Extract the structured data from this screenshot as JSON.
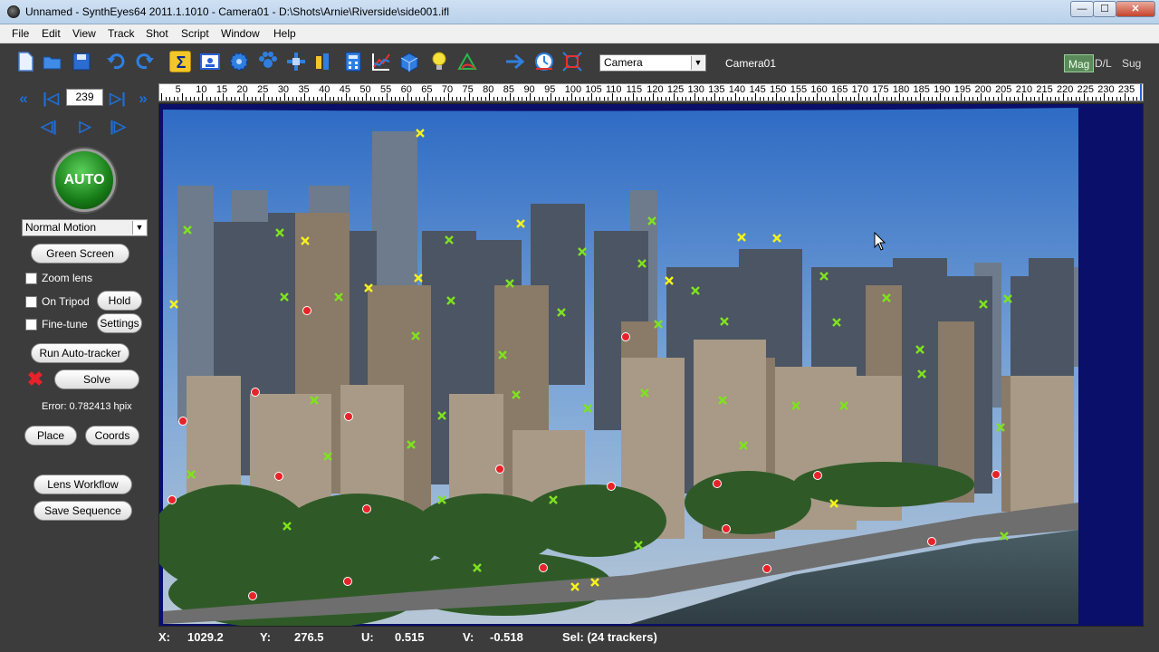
{
  "window": {
    "title": "Unnamed - SynthEyes64 2011.1.1010 - Camera01 - D:\\Shots\\Arnie\\Riverside\\side001.ifl",
    "min_label": "—",
    "max_label": "☐",
    "close_label": "✕"
  },
  "menu": [
    "File",
    "Edit",
    "View",
    "Track",
    "Shot",
    "Script",
    "Window",
    "Help"
  ],
  "toolbar": {
    "icons": [
      "new-file-icon",
      "open-folder-icon",
      "save-icon",
      "undo-icon",
      "redo-icon",
      "sigma-icon",
      "camera-view-icon",
      "gear-icon",
      "paw-icon",
      "transform-icon",
      "coordinate-icon",
      "calculator-icon",
      "graph-icon",
      "cube-icon",
      "light-bulb-icon",
      "perspective-icon",
      "arrow-right-icon",
      "clock-icon",
      "fit-icon"
    ],
    "camera_select_value": "Camera",
    "camera_label": "Camera01",
    "view_tabs": [
      "Mag",
      "D/L",
      "Sug"
    ]
  },
  "nav": {
    "frame_value": "239"
  },
  "left_panel": {
    "auto_label": "AUTO",
    "motion_select_value": "Normal Motion",
    "green_screen_label": "Green Screen",
    "zoom_lens_label": "Zoom lens",
    "on_tripod_label": "On Tripod",
    "hold_label": "Hold",
    "fine_tune_label": "Fine-tune",
    "settings_label": "Settings",
    "run_auto_tracker_label": "Run Auto-tracker",
    "solve_label": "Solve",
    "error_text": "Error: 0.782413 hpix",
    "place_label": "Place",
    "coords_label": "Coords",
    "lens_workflow_label": "Lens Workflow",
    "save_sequence_label": "Save Sequence"
  },
  "timeline": {
    "labels": [
      "5",
      "10",
      "15",
      "20",
      "25",
      "30",
      "35",
      "40",
      "45",
      "50",
      "55",
      "60",
      "65",
      "70",
      "75",
      "80",
      "85",
      "90",
      "95",
      "100",
      "105",
      "110",
      "115",
      "120",
      "125",
      "130",
      "135",
      "140",
      "145",
      "150",
      "155",
      "160",
      "165",
      "170",
      "175",
      "180",
      "185",
      "190",
      "195",
      "200",
      "205",
      "210",
      "215",
      "220",
      "225",
      "230",
      "235"
    ],
    "current_frame": 239,
    "max_frame": 239
  },
  "status": {
    "x_label": "X:",
    "x_value": "1029.2",
    "y_label": "Y:",
    "y_value": "276.5",
    "u_label": "U:",
    "u_value": "0.515",
    "v_label": "V:",
    "v_value": "-0.518",
    "selection": "Sel: (24 trackers)"
  },
  "colors": {
    "tracker_green": "#7fe21f",
    "tracker_yellow": "#f6f21a",
    "tracker_red": "#e8222a",
    "accent_blue": "#1e6fd6"
  }
}
